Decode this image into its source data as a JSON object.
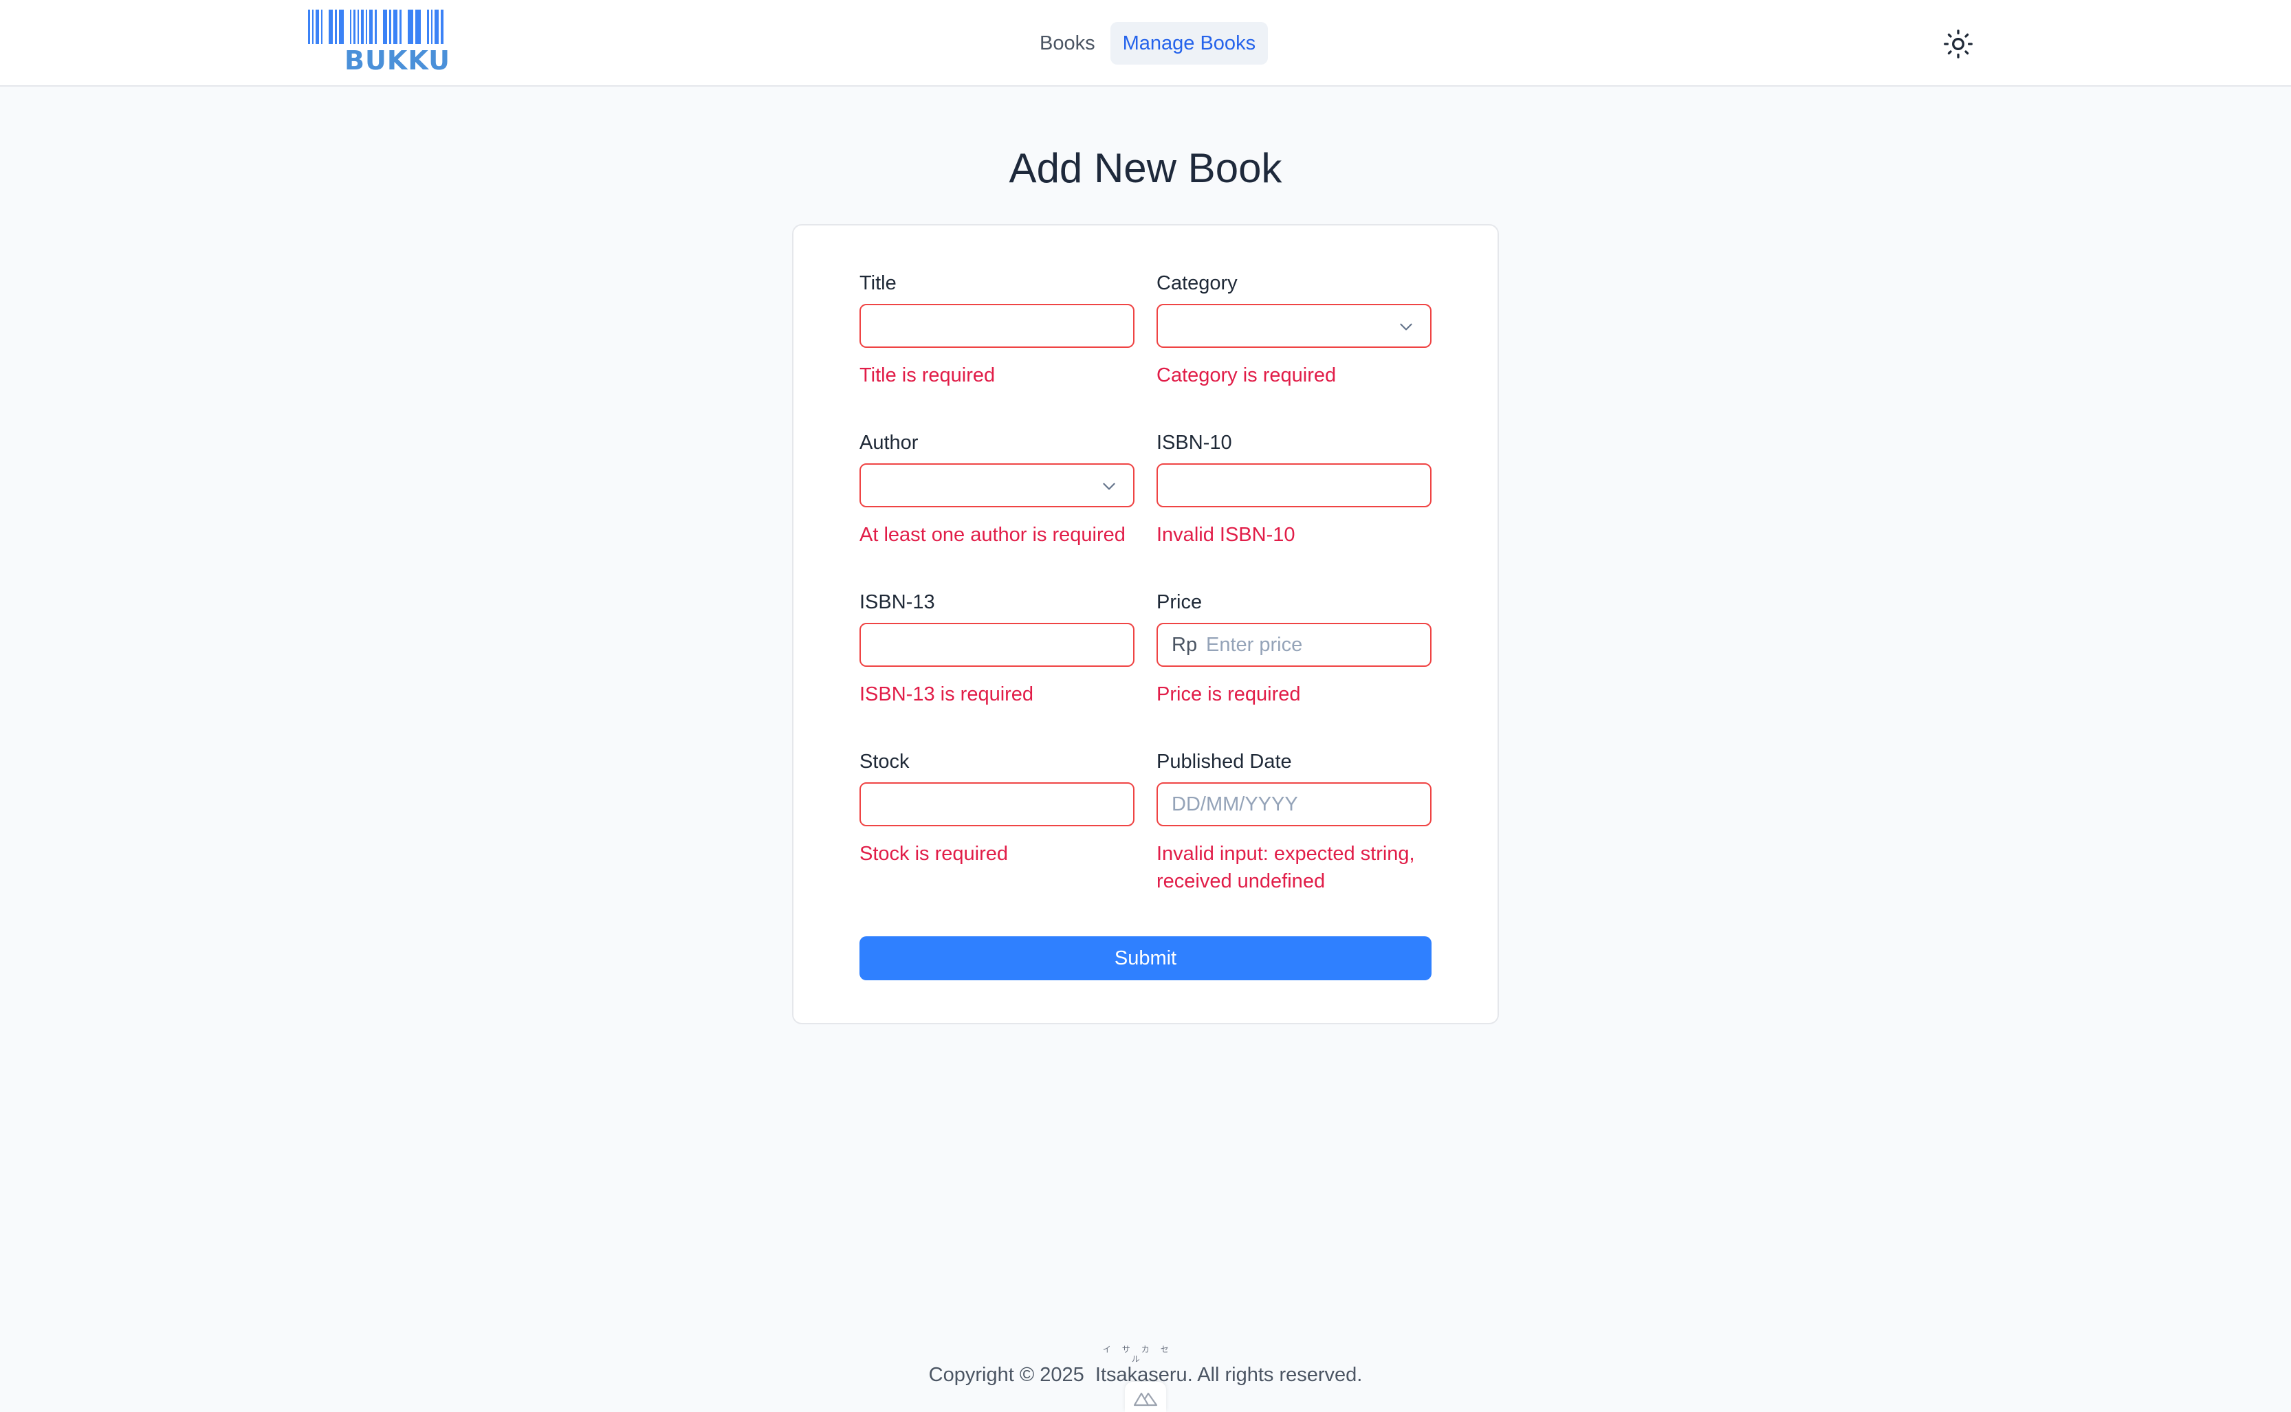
{
  "header": {
    "logo_text": "BUKKU",
    "logo_icon": "barcode-logo",
    "nav": [
      {
        "label": "Books",
        "active": false
      },
      {
        "label": "Manage Books",
        "active": true
      }
    ],
    "theme_icon": "sun-icon"
  },
  "page": {
    "title": "Add New Book"
  },
  "form": {
    "title": {
      "label": "Title",
      "value": "",
      "error": "Title is required"
    },
    "category": {
      "label": "Category",
      "value": "",
      "error": "Category is required"
    },
    "author": {
      "label": "Author",
      "value": "",
      "error": "At least one author is required"
    },
    "isbn10": {
      "label": "ISBN-10",
      "value": "",
      "error": "Invalid ISBN-10"
    },
    "isbn13": {
      "label": "ISBN-13",
      "value": "",
      "error": "ISBN-13 is required"
    },
    "price": {
      "label": "Price",
      "prefix": "Rp",
      "placeholder": "Enter price",
      "value": "",
      "error": "Price is required"
    },
    "stock": {
      "label": "Stock",
      "value": "",
      "error": "Stock is required"
    },
    "published_date": {
      "label": "Published Date",
      "placeholder": "DD/MM/YYYY",
      "value": "",
      "error": "Invalid input: expected string, received undefined"
    },
    "submit_label": "Submit"
  },
  "footer": {
    "copyright_prefix": "Copyright © 2025",
    "name": "Itsakaseru",
    "name_ruby": "イサカセル",
    "suffix": ". All rights reserved.",
    "badge_icon": "nuxt-icon"
  },
  "colors": {
    "accent": "#2f80ff",
    "error": "#e11d48",
    "error_border": "#ef4444",
    "logo": "#4a90d9"
  }
}
